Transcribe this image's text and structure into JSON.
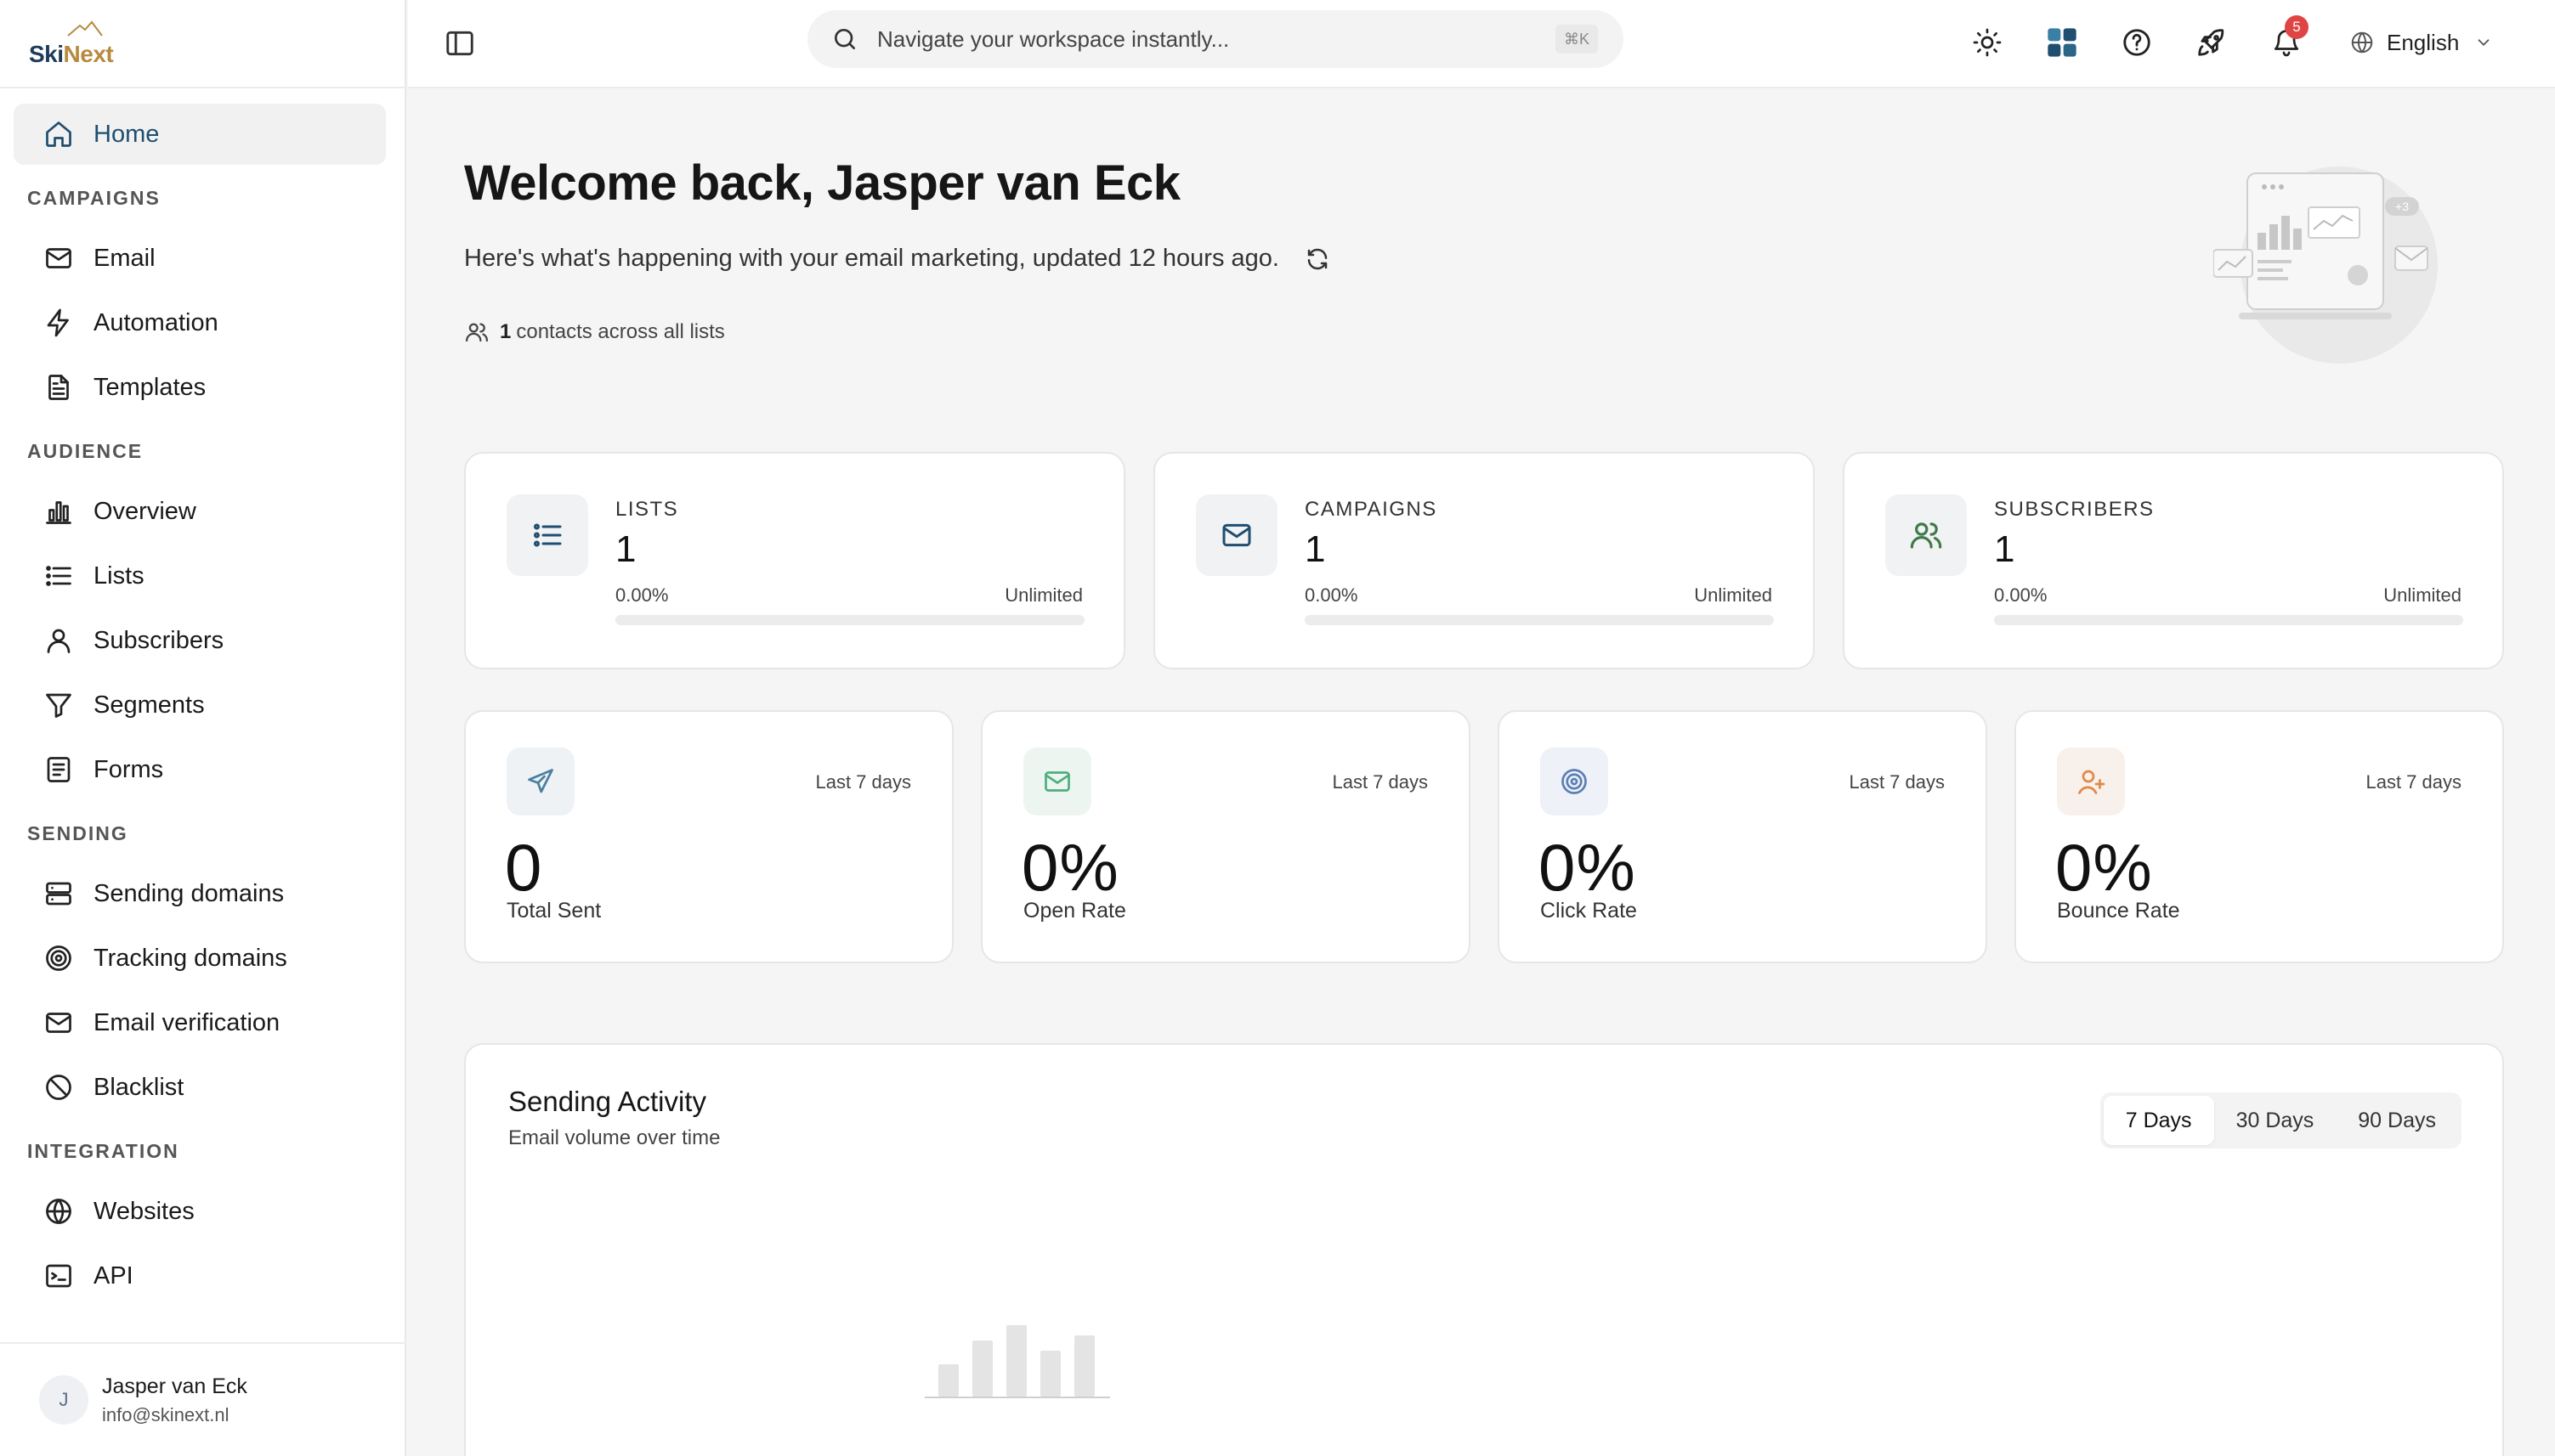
{
  "brand": {
    "part1": "Ski",
    "part2": "Next"
  },
  "nav": {
    "home": "Home",
    "sections": {
      "campaigns": "CAMPAIGNS",
      "audience": "AUDIENCE",
      "sending": "SENDING",
      "integration": "INTEGRATION"
    },
    "campaigns": [
      "Email",
      "Automation",
      "Templates"
    ],
    "audience": [
      "Overview",
      "Lists",
      "Subscribers",
      "Segments",
      "Forms"
    ],
    "sending": [
      "Sending domains",
      "Tracking domains",
      "Email verification",
      "Blacklist"
    ],
    "integration": [
      "Websites",
      "API"
    ]
  },
  "user": {
    "initial": "J",
    "name": "Jasper van Eck",
    "email": "info@skinext.nl"
  },
  "topbar": {
    "search_placeholder": "Navigate your workspace instantly...",
    "shortcut": "⌘K",
    "notification_count": "5",
    "language": "English"
  },
  "welcome": {
    "title": "Welcome back, Jasper van Eck",
    "subtitle": "Here's what's happening with your email marketing, updated 12 hours ago.",
    "contacts_count": "1",
    "contacts_text": "contacts across all lists",
    "illustration_badge": "+3"
  },
  "stats": [
    {
      "label": "LISTS",
      "value": "1",
      "percent": "0.00%",
      "limit": "Unlimited",
      "progress": 0
    },
    {
      "label": "CAMPAIGNS",
      "value": "1",
      "percent": "0.00%",
      "limit": "Unlimited",
      "progress": 0
    },
    {
      "label": "SUBSCRIBERS",
      "value": "1",
      "percent": "0.00%",
      "limit": "Unlimited",
      "progress": 0
    }
  ],
  "metrics": [
    {
      "period": "Last 7 days",
      "value": "0",
      "label": "Total Sent",
      "color": "#4a7fa0"
    },
    {
      "period": "Last 7 days",
      "value": "0%",
      "label": "Open Rate",
      "color": "#4caf7d"
    },
    {
      "period": "Last 7 days",
      "value": "0%",
      "label": "Click Rate",
      "color": "#5a7fb5"
    },
    {
      "period": "Last 7 days",
      "value": "0%",
      "label": "Bounce Rate",
      "color": "#e0894a"
    }
  ],
  "activity": {
    "title": "Sending Activity",
    "subtitle": "Email volume over time",
    "tabs": [
      "7 Days",
      "30 Days",
      "90 Days"
    ],
    "active_tab": "7 Days"
  },
  "colors": {
    "accent": "#1f4e70",
    "brand_gold": "#b78a3d",
    "badge": "#e04545"
  }
}
